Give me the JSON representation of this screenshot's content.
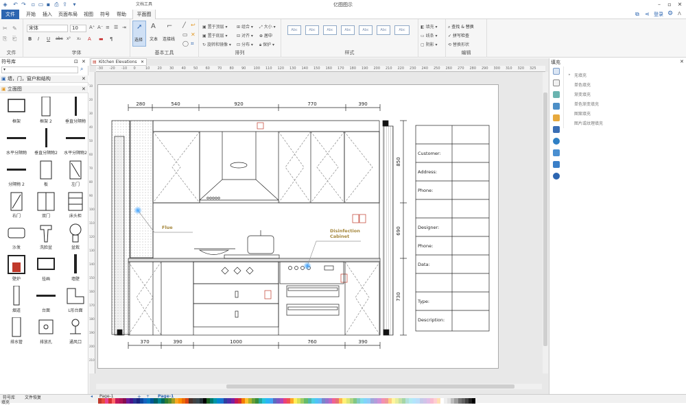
{
  "app": {
    "title": "亿图图示",
    "context_tab_group": "文档工具",
    "menu": [
      "文件",
      "开始",
      "插入",
      "页面布局",
      "视图",
      "符号",
      "帮助",
      "平面图"
    ],
    "login": "登录"
  },
  "ribbon": {
    "groups": [
      "文件",
      "字体",
      "基本工具",
      "排列",
      "样式",
      "编辑"
    ],
    "font": {
      "family": "宋体",
      "size": "10"
    },
    "font_buttons": [
      "B",
      "I",
      "U",
      "abc",
      "x²",
      "x₂",
      "A"
    ],
    "basic_tools": [
      "选择",
      "文本",
      "连接线"
    ],
    "arrange": [
      "置于顶层",
      "置于底层",
      "组合",
      "对齐",
      "旋转和镜像",
      "分布",
      "大小",
      "居中",
      "保护"
    ],
    "style_box_label": "Abc",
    "style_items": [
      "填充",
      "线条",
      "阴影"
    ],
    "edit": [
      "查找 & 替换",
      "拼写检查",
      "替换形状"
    ]
  },
  "symbol_panel": {
    "title": "符号库",
    "search_placeholder": "",
    "categories": [
      "墙，门，窗户和结构",
      "立面图"
    ],
    "symbols": [
      "框架",
      "框架 2",
      "垂直分隔物",
      "水平分隔物",
      "垂直分隔物2",
      "水平分隔物2",
      "分隔物 2",
      "板",
      "左门",
      "右门",
      "双门",
      "床头柜",
      "沙发",
      "洗脸盆",
      "盆栽",
      "壁炉",
      "挂画",
      "墙壁",
      "烟道",
      "台面",
      "L形台面",
      "排水管",
      "排放孔",
      "通风口"
    ]
  },
  "canvas": {
    "doc_tab": "Kitchen Elevations",
    "ruler_ticks": [
      "-30",
      "-20",
      "-10",
      "0",
      "10",
      "20",
      "30",
      "40",
      "50",
      "60",
      "70",
      "80",
      "90",
      "100",
      "110",
      "120",
      "130",
      "140",
      "150",
      "160",
      "170",
      "180",
      "190",
      "200",
      "210",
      "220",
      "230",
      "240",
      "250",
      "260",
      "270",
      "280",
      "290",
      "300",
      "310",
      "320",
      "325"
    ],
    "vruler_ticks": [
      "10",
      "20",
      "30",
      "40",
      "50",
      "60",
      "70",
      "80",
      "90",
      "100",
      "110",
      "120",
      "130",
      "140",
      "150",
      "160",
      "170",
      "180",
      "190",
      "200",
      "210"
    ],
    "drawing": {
      "top_dims": [
        "280",
        "540",
        "920",
        "770",
        "390"
      ],
      "bottom_dims": [
        "370",
        "390",
        "1000",
        "760",
        "390"
      ],
      "side_dims": [
        "850",
        "690",
        "730"
      ],
      "labels": {
        "flue": "Flue",
        "cabinet": "Disinfection\nCabinet",
        "cabinet_line1": "Disinfection",
        "cabinet_line2": "Cabinet"
      },
      "info_fields": [
        "Customer:",
        "Address:",
        "Phone:",
        "",
        "Designer:",
        "Phone:",
        "Data:",
        "",
        "Type:",
        "Description:"
      ]
    }
  },
  "fill_panel": {
    "title": "填充",
    "options": [
      "无填充",
      "单色填充",
      "渐变填充",
      "单色渐变填充",
      "图案填充",
      "图片或纹理填充"
    ]
  },
  "status": {
    "tabs": [
      "符号库",
      "文件恢复"
    ],
    "pages": [
      "Page-1",
      "Page-1"
    ],
    "fill_label": "填充"
  },
  "palette": [
    "#c0392b",
    "#e74c3c",
    "#e84393",
    "#d63031",
    "#ff6b6b",
    "#c2185b",
    "#ad1457",
    "#880e4f",
    "#6a1b9a",
    "#4a148c",
    "#283593",
    "#1a237e",
    "#0d47a1",
    "#1565c0",
    "#0277bd",
    "#01579b",
    "#006064",
    "#00838f",
    "#00695c",
    "#2e7d32",
    "#558b2f",
    "#9e9d24",
    "#f9a825",
    "#ff8f00",
    "#ef6c00",
    "#d84315",
    "#4e342e",
    "#424242",
    "#37474f",
    "#263238",
    "#000000",
    "#1b5e20",
    "#00796b",
    "#0097a7",
    "#0288d1",
    "#1976d2",
    "#303f9f",
    "#512da8",
    "#7b1fa2",
    "#c2185b",
    "#d32f2f",
    "#f57c00",
    "#fbc02d",
    "#afb42b",
    "#689f38",
    "#388e3c",
    "#26a69a",
    "#26c6da",
    "#29b6f6",
    "#42a5f5",
    "#5c6bc0",
    "#7e57c2",
    "#ab47bc",
    "#ec407a",
    "#ef5350",
    "#ffa726",
    "#ffee58",
    "#d4e157",
    "#9ccc65",
    "#66bb6a",
    "#4db6ac",
    "#4dd0e1",
    "#4fc3f7",
    "#64b5f6",
    "#7986cb",
    "#9575cd",
    "#ba68c8",
    "#f06292",
    "#e57373",
    "#ffb74d",
    "#fff176",
    "#dce775",
    "#aed581",
    "#81c784",
    "#80cbc4",
    "#80deea",
    "#81d4fa",
    "#90caf9",
    "#9fa8da",
    "#b39ddb",
    "#ce93d8",
    "#f48fb1",
    "#ef9a9a",
    "#ffcc80",
    "#fff59d",
    "#e6ee9c",
    "#c5e1a5",
    "#a5d6a7",
    "#b2dfdb",
    "#b2ebf2",
    "#b3e5fc",
    "#bbdefb",
    "#c5cae9",
    "#d1c4e9",
    "#e1bee7",
    "#f8bbd0",
    "#ffcdd2",
    "#ffe0b2",
    "#ffffff",
    "#eeeeee",
    "#e0e0e0",
    "#bdbdbd",
    "#9e9e9e",
    "#757575",
    "#616161",
    "#424242",
    "#212121",
    "#000000"
  ]
}
